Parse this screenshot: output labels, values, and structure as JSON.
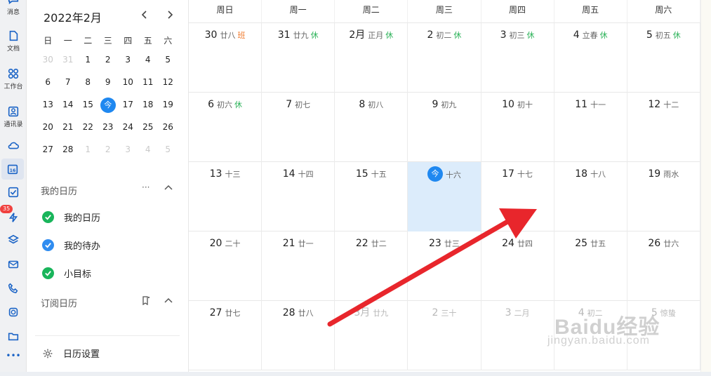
{
  "rail": {
    "items": [
      {
        "label": "消息",
        "icon": "message-icon"
      },
      {
        "label": "文档",
        "icon": "document-icon"
      },
      {
        "label": "工作台",
        "icon": "workbench-icon"
      },
      {
        "label": "通讯录",
        "icon": "contacts-icon"
      },
      {
        "label": "",
        "icon": "cloud-icon"
      },
      {
        "label": "16",
        "icon": "calendar-icon"
      },
      {
        "label": "",
        "icon": "todo-icon"
      },
      {
        "label": "35",
        "icon": "ding-icon"
      },
      {
        "label": "",
        "icon": "layers-icon"
      },
      {
        "label": "",
        "icon": "mail-icon"
      },
      {
        "label": "",
        "icon": "phone-icon"
      },
      {
        "label": "",
        "icon": "video-icon"
      },
      {
        "label": "",
        "icon": "folder-icon"
      },
      {
        "label": "•••",
        "icon": "more-icon"
      }
    ]
  },
  "mini_calendar": {
    "title": "2022年2月",
    "weekdays": [
      "日",
      "一",
      "二",
      "三",
      "四",
      "五",
      "六"
    ],
    "weeks": [
      [
        "30",
        "31",
        "1",
        "2",
        "3",
        "4",
        "5"
      ],
      [
        "6",
        "7",
        "8",
        "9",
        "10",
        "11",
        "12"
      ],
      [
        "13",
        "14",
        "15",
        "今",
        "17",
        "18",
        "19"
      ],
      [
        "20",
        "21",
        "22",
        "23",
        "24",
        "25",
        "26"
      ],
      [
        "27",
        "28",
        "1",
        "2",
        "3",
        "4",
        "5"
      ]
    ]
  },
  "my_calendars": {
    "title": "我的日历",
    "more": "···",
    "items": [
      {
        "label": "我的日历",
        "color": "#19b55b"
      },
      {
        "label": "我的待办",
        "color": "#2f8cf0"
      },
      {
        "label": "小目标",
        "color": "#19b55b"
      }
    ]
  },
  "subscribed": {
    "title": "订阅日历"
  },
  "settings": {
    "label": "日历设置"
  },
  "month_view": {
    "weekdays": [
      "周日",
      "周一",
      "周二",
      "周三",
      "周四",
      "周五",
      "周六"
    ],
    "weeks": [
      [
        {
          "num": "30",
          "lunar": "廿八",
          "tag": "班",
          "tag_type": "work"
        },
        {
          "num": "31",
          "lunar": "廿九",
          "tag": "休",
          "tag_type": "rest"
        },
        {
          "num": "2月",
          "lunar": "正月",
          "tag": "休",
          "tag_type": "rest"
        },
        {
          "num": "2",
          "lunar": "初二",
          "tag": "休",
          "tag_type": "rest"
        },
        {
          "num": "3",
          "lunar": "初三",
          "tag": "休",
          "tag_type": "rest"
        },
        {
          "num": "4",
          "lunar": "立春",
          "tag": "休",
          "tag_type": "rest"
        },
        {
          "num": "5",
          "lunar": "初五",
          "tag": "休",
          "tag_type": "rest"
        }
      ],
      [
        {
          "num": "6",
          "lunar": "初六",
          "tag": "休",
          "tag_type": "rest"
        },
        {
          "num": "7",
          "lunar": "初七",
          "tag": "",
          "tag_type": ""
        },
        {
          "num": "8",
          "lunar": "初八",
          "tag": "",
          "tag_type": ""
        },
        {
          "num": "9",
          "lunar": "初九",
          "tag": "",
          "tag_type": ""
        },
        {
          "num": "10",
          "lunar": "初十",
          "tag": "",
          "tag_type": ""
        },
        {
          "num": "11",
          "lunar": "十一",
          "tag": "",
          "tag_type": ""
        },
        {
          "num": "12",
          "lunar": "十二",
          "tag": "",
          "tag_type": ""
        }
      ],
      [
        {
          "num": "13",
          "lunar": "十三",
          "tag": "",
          "tag_type": ""
        },
        {
          "num": "14",
          "lunar": "十四",
          "tag": "",
          "tag_type": ""
        },
        {
          "num": "15",
          "lunar": "十五",
          "tag": "",
          "tag_type": ""
        },
        {
          "num": "今",
          "lunar": "十六",
          "tag": "",
          "tag_type": "",
          "today": true
        },
        {
          "num": "17",
          "lunar": "十七",
          "tag": "",
          "tag_type": ""
        },
        {
          "num": "18",
          "lunar": "十八",
          "tag": "",
          "tag_type": ""
        },
        {
          "num": "19",
          "lunar": "雨水",
          "tag": "",
          "tag_type": ""
        }
      ],
      [
        {
          "num": "20",
          "lunar": "二十",
          "tag": "",
          "tag_type": ""
        },
        {
          "num": "21",
          "lunar": "廿一",
          "tag": "",
          "tag_type": ""
        },
        {
          "num": "22",
          "lunar": "廿二",
          "tag": "",
          "tag_type": ""
        },
        {
          "num": "23",
          "lunar": "廿三",
          "tag": "",
          "tag_type": ""
        },
        {
          "num": "24",
          "lunar": "廿四",
          "tag": "",
          "tag_type": ""
        },
        {
          "num": "25",
          "lunar": "廿五",
          "tag": "",
          "tag_type": ""
        },
        {
          "num": "26",
          "lunar": "廿六",
          "tag": "",
          "tag_type": ""
        }
      ],
      [
        {
          "num": "27",
          "lunar": "廿七",
          "tag": "",
          "tag_type": ""
        },
        {
          "num": "28",
          "lunar": "廿八",
          "tag": "",
          "tag_type": ""
        },
        {
          "num": "3月",
          "lunar": "廿九",
          "tag": "",
          "tag_type": "",
          "muted": true
        },
        {
          "num": "2",
          "lunar": "三十",
          "tag": "",
          "tag_type": "",
          "muted": true
        },
        {
          "num": "3",
          "lunar": "二月",
          "tag": "",
          "tag_type": "",
          "muted": true
        },
        {
          "num": "4",
          "lunar": "初二",
          "tag": "",
          "tag_type": "",
          "muted": true
        },
        {
          "num": "5",
          "lunar": "惊蛰",
          "tag": "",
          "tag_type": "",
          "muted": true
        }
      ]
    ]
  },
  "watermark": {
    "brand": "Baidu经验",
    "sub": "jingyan.baidu.com"
  },
  "colors": {
    "accent": "#1f88f0",
    "rest": "#2bb258",
    "work": "#f0792a",
    "today_bg": "#dcecfb",
    "arrow": "#e8262c"
  }
}
